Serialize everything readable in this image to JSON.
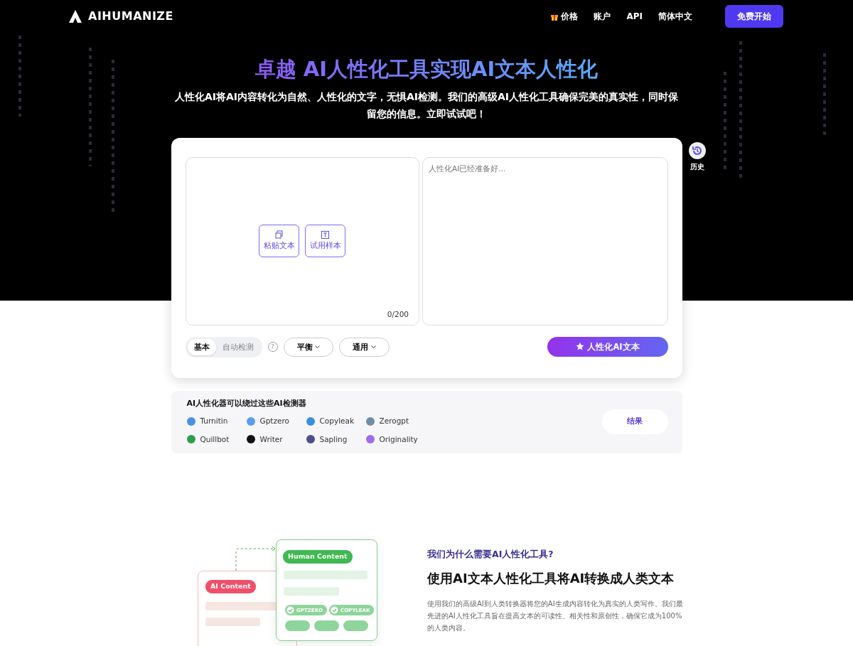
{
  "header": {
    "logo": "AIHUMANIZE",
    "nav": [
      {
        "label": "价格",
        "kind": "gift"
      },
      {
        "label": "账户",
        "kind": "plain"
      },
      {
        "label": "API",
        "kind": "plain"
      },
      {
        "label": "简体中文",
        "kind": "plain"
      }
    ],
    "cta": "免费开始"
  },
  "hero": {
    "title_a": "卓越 AI人性化工具实现AI文本人性化",
    "subtitle": "人性化AI将AI内容转化为自然、人性化的文字，无惧AI检测。我们的高级AI人性化工具确保完美的真实性，同时保留您的信息。立即试试吧！"
  },
  "history": {
    "label": "历史"
  },
  "editor": {
    "actions": [
      {
        "label": "粘贴文本",
        "kind": "copy"
      },
      {
        "label": "试用样本",
        "kind": "text"
      }
    ],
    "counter": "0/200",
    "output_placeholder": "人性化AI已经准备好..."
  },
  "modes": [
    {
      "label": "基本",
      "selected": true
    },
    {
      "label": "自动检测",
      "selected": false
    }
  ],
  "help": "?",
  "dropdowns": [
    "平衡",
    "通用"
  ],
  "submit": "人性化AI文本",
  "detectors": {
    "title": "AI人性化器可以绕过这些AI检测器",
    "items": [
      {
        "name": "Turnitin",
        "color": "#4a90e2"
      },
      {
        "name": "Gptzero",
        "color": "#5b9cf0"
      },
      {
        "name": "Copyleak",
        "color": "#3a8fd8"
      },
      {
        "name": "Zerogpt",
        "color": "#6f8fa8"
      },
      {
        "name": "Quillbot",
        "color": "#2e9e4f"
      },
      {
        "name": "Writer",
        "color": "#111111"
      },
      {
        "name": "Sapling",
        "color": "#4b4f8a"
      },
      {
        "name": "Originality",
        "color": "#9b6cf0"
      }
    ],
    "result": "结果"
  },
  "why": {
    "ai_tag": "AI Content",
    "human_tag": "Human Content",
    "checks": [
      "GPTZERO",
      "COPYLEAK"
    ],
    "eyebrow": "我们为什么需要AI人性化工具?",
    "heading": "使用AI文本人性化工具将AI转换成人类文本",
    "body": "使用我们的高级AI到人类转换器将您的AI生成内容转化为真实的人类写作。我们最先进的AI人性化工具旨在提高文本的可读性、相关性和原创性，确保它成为100%的人类内容。"
  }
}
